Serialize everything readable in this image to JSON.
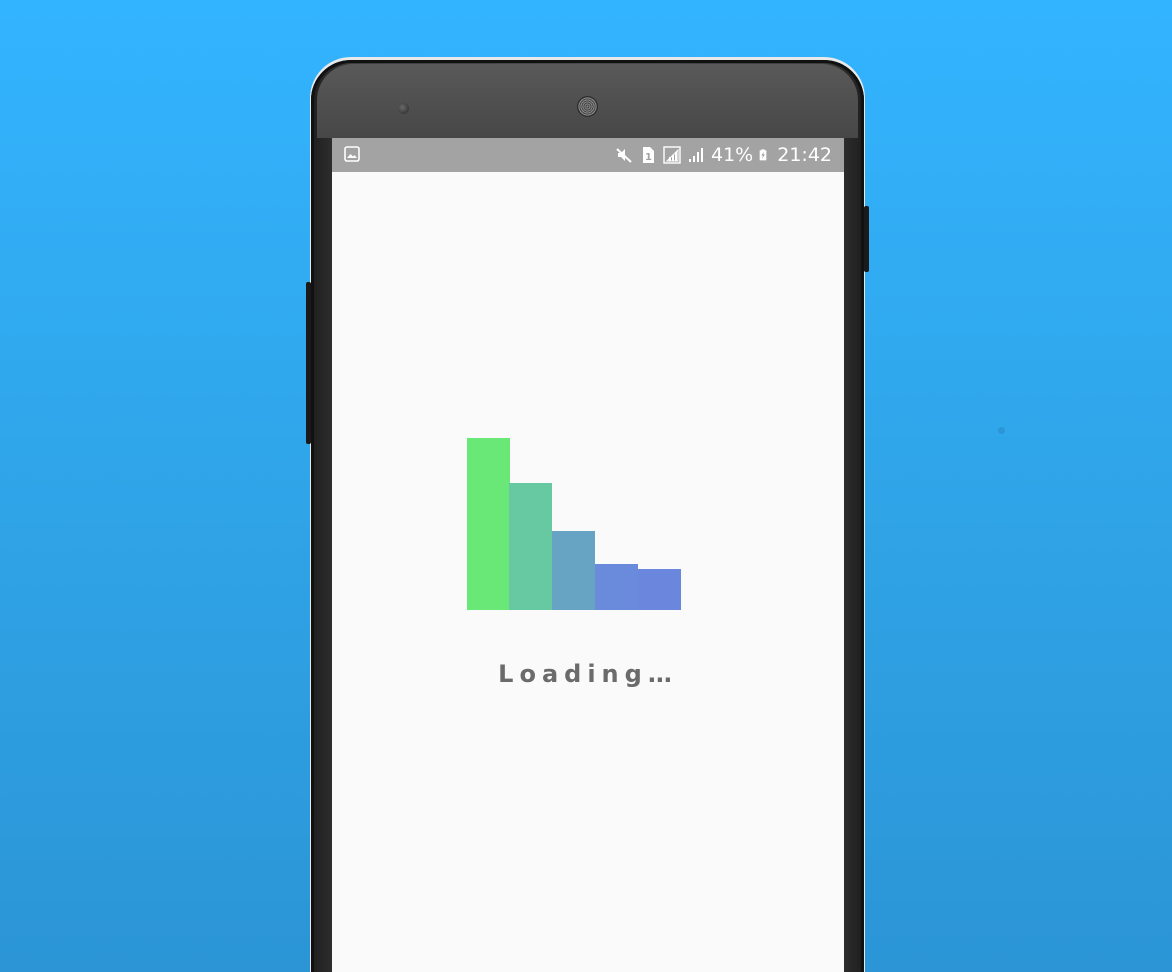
{
  "status_bar": {
    "battery_percent": "41%",
    "time": "21:42",
    "sim_label": "1",
    "icons": [
      "image-icon",
      "mute-icon",
      "sim-icon",
      "signal-box-icon",
      "signal-icon",
      "battery-charging-icon"
    ]
  },
  "loader": {
    "bar_levels": [
      1.0,
      0.74,
      0.46,
      0.27,
      0.24
    ],
    "bar_colors": [
      "#69e878",
      "#67c9a2",
      "#67a3c3",
      "#6a8bdb",
      "#6b86dd"
    ],
    "label": "Loading…"
  },
  "colors": {
    "background": "#33b4ff",
    "screen": "#fafafa",
    "status_bar": "#a3a3a3",
    "label": "#6b6b6b"
  }
}
